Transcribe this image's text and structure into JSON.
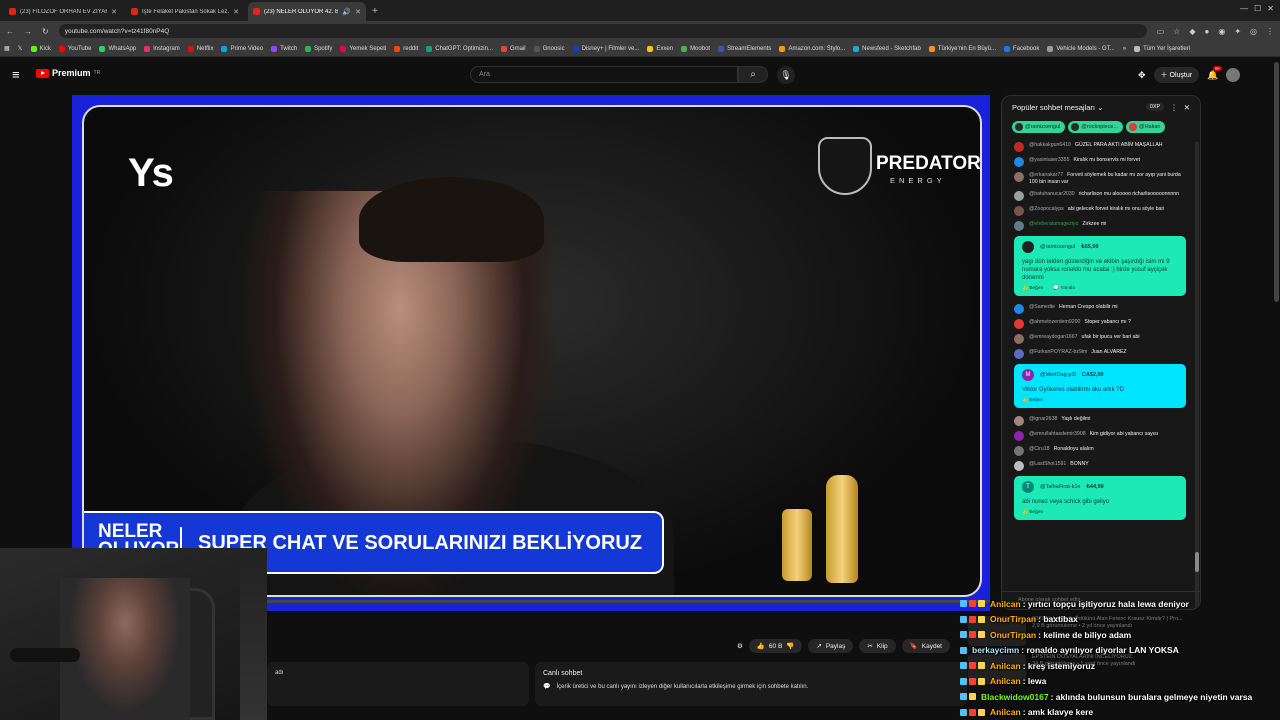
{
  "browser": {
    "tabs": [
      {
        "title": "(23) FİLOZOF ORHAN EV ZİYARE...",
        "active": false
      },
      {
        "title": "İşte Felaket Pakistan Sokak Lez...",
        "active": false
      },
      {
        "title": "(23) NELER OLUYOR 42. BÖ...",
        "active": true
      }
    ],
    "new_tab": "+",
    "url": "youtube.com/watch?v=tz41f80nP4Q",
    "bookmarks": [
      "Kick",
      "YouTube",
      "WhatsApp",
      "Instagram",
      "Netflix",
      "Prime Video",
      "Twitch",
      "Spotify",
      "Yemek Sepeti",
      "reddit",
      "ChatGPT: Optimizin...",
      "Gmail",
      "Gnoosic",
      "Disney+ | Filmler ve...",
      "Exxen",
      "Moobot",
      "StreamElements",
      "Amazon.com: Stylo...",
      "Newsfeed - Sketchfab",
      "Türkiye'nin En Büyü...",
      "Facebook",
      "Vehicle Models - GT..."
    ],
    "bookmarks_more": "»",
    "all_bookmarks": "Tüm Yer İşaretleri"
  },
  "youtube": {
    "logo_text": "Premium",
    "logo_region": "TR",
    "search_placeholder": "Ara",
    "create_label": "Oluştur",
    "notif_count": "9+"
  },
  "video": {
    "channel_logo": "Ys",
    "sponsor": "PREDATOR",
    "sponsor_sub": "ENERGY",
    "lower_left": "NELER OLUYOR",
    "lower_text": "SUPER CHAT VE SORULARINIZI BEKLİYORUZ"
  },
  "chat": {
    "header": "Popüler sohbet mesajları",
    "oxp": "0XP",
    "pills": [
      "@ramizsengul",
      "@rocknpiece...",
      "@Hakan"
    ],
    "messages": [
      {
        "author": "@hakkakgun6410",
        "text": "GÜZEL PARA AKTI ABİM MAŞALLAH",
        "color": "#c62828"
      },
      {
        "author": "@yasintaser3355",
        "text": "Kiralık mı bonservis mi forvet",
        "color": "#1e88e5"
      },
      {
        "author": "@erkanakar77",
        "text": "Forveti söylemek bu kadar mı zor ayıp yani burda 100 bin insan var",
        "color": "#8d6e63"
      },
      {
        "author": "@batuhanucar2030",
        "text": "richarlison mu alooooo richarlisooooonnnnn",
        "color": "#9e9e9e"
      },
      {
        "author": "@Zoopocalyps",
        "text": "abi gelecek forvet kiralık mı onu söyle bari",
        "color": "#795548"
      },
      {
        "author": "@efeberatamageziyo",
        "text": "Zirkzee mi",
        "color": "#607d8b"
      }
    ],
    "superchat1": {
      "author": "@ramizsengul",
      "amount": "₺55,00",
      "text": "yagı dün telden gösterdiğin ve ekibin şaşırdığı isim mi 9 numara yoksa ronaldo mu acaba :) birde yusuf ayçiçek donermi",
      "like": "Beğen",
      "reply": "Yanıtla"
    },
    "messages2": [
      {
        "author": "@Samedte",
        "text": "Hernan Crespo olabilir mi",
        "color": "#1e88e5"
      },
      {
        "author": "@ahmetozerdem9200",
        "text": "Stoper yabancı mı ?",
        "color": "#e53935"
      },
      {
        "author": "@emreaydogan1667",
        "text": "ufak bir ipucu ver bari abi",
        "color": "#8d6e63"
      },
      {
        "author": "@FurkanPOYRAZ-bz9im",
        "text": "Juan ALVAREZ",
        "color": "#5c6bc0"
      }
    ],
    "superchat2": {
      "author": "@MertDag-p3l",
      "amount": "CA$2,00",
      "text": "Viktor Gyökeres olabilirmi oku artık ?D",
      "like": "Beğen",
      "avatar_letter": "M"
    },
    "messages3": [
      {
        "author": "@ignar2638",
        "text": "Yaşlı değilmi",
        "color": "#a1887f"
      },
      {
        "author": "@emrullahtasdemir3908",
        "text": "Kim gidiyor abi yabancı sayısı",
        "color": "#8e24aa"
      },
      {
        "author": "@Ciru18",
        "text": "Ronaldoyu alalım",
        "color": "#757575"
      },
      {
        "author": "@LastShot1591",
        "text": "BONNY",
        "color": "#bdbdbd"
      }
    ],
    "superchat3": {
      "author": "@TalhaFirat-k1e",
      "amount": "₺44,99",
      "text": "abi nunez veya schick gibi geliyo",
      "like": "Beğen",
      "avatar_letter": "T"
    },
    "input_placeholder": "Abone olarak sohbet edin..."
  },
  "below": {
    "likes": "60 B",
    "share": "Paylaş",
    "clip": "Klip",
    "save": "Kaydet",
    "desc_frag": "adı",
    "live_title": "Canlı sohbet",
    "live_desc": "İçerik üretici ve bu canlı yayını izleyen diğer kullanıcılarla etkileşime girmek için sohbete katılın."
  },
  "related": [
    {
      "title": "2023 Nobel Fizik Ödülünü Alan Ferenc Krausz Kimdir? | Pro...",
      "meta": "2,9 B görüntüleme • 2 yıl önce yayınlandı"
    },
    {
      "title": "EPSTEIN DOSYALARINI İNCELİYORUZ.",
      "meta": "34 B görüntüleme • 1 saat önce yayınlandı"
    }
  ],
  "overlay_chat": [
    {
      "name": "Anilcan",
      "text": "yırtıcı topçu işitiyoruz hala lewa deniyor",
      "color": "#ffb300"
    },
    {
      "name": "OnurTirpan",
      "text": "baxtibax",
      "color": "#ffb300"
    },
    {
      "name": "OnurTirpan",
      "text": "kelime de biliyo adam",
      "color": "#ffb300"
    },
    {
      "name": "berkaycimn",
      "text": "ronaldo ayrılıyor diyorlar LAN YOKSA",
      "color": "#b3e5fc"
    },
    {
      "name": "Anilcan",
      "text": "kreş istemiyoruz",
      "color": "#ffb300"
    },
    {
      "name": "Anilcan",
      "text": "lewa",
      "color": "#ffb300"
    },
    {
      "name": "Blackwidow0167",
      "text": "aklında bulunsun buralara gelmeye niyetin varsa",
      "color": "#76ff03"
    },
    {
      "name": "Anilcan",
      "text": "amk klavye kere",
      "color": "#ffb300"
    }
  ]
}
